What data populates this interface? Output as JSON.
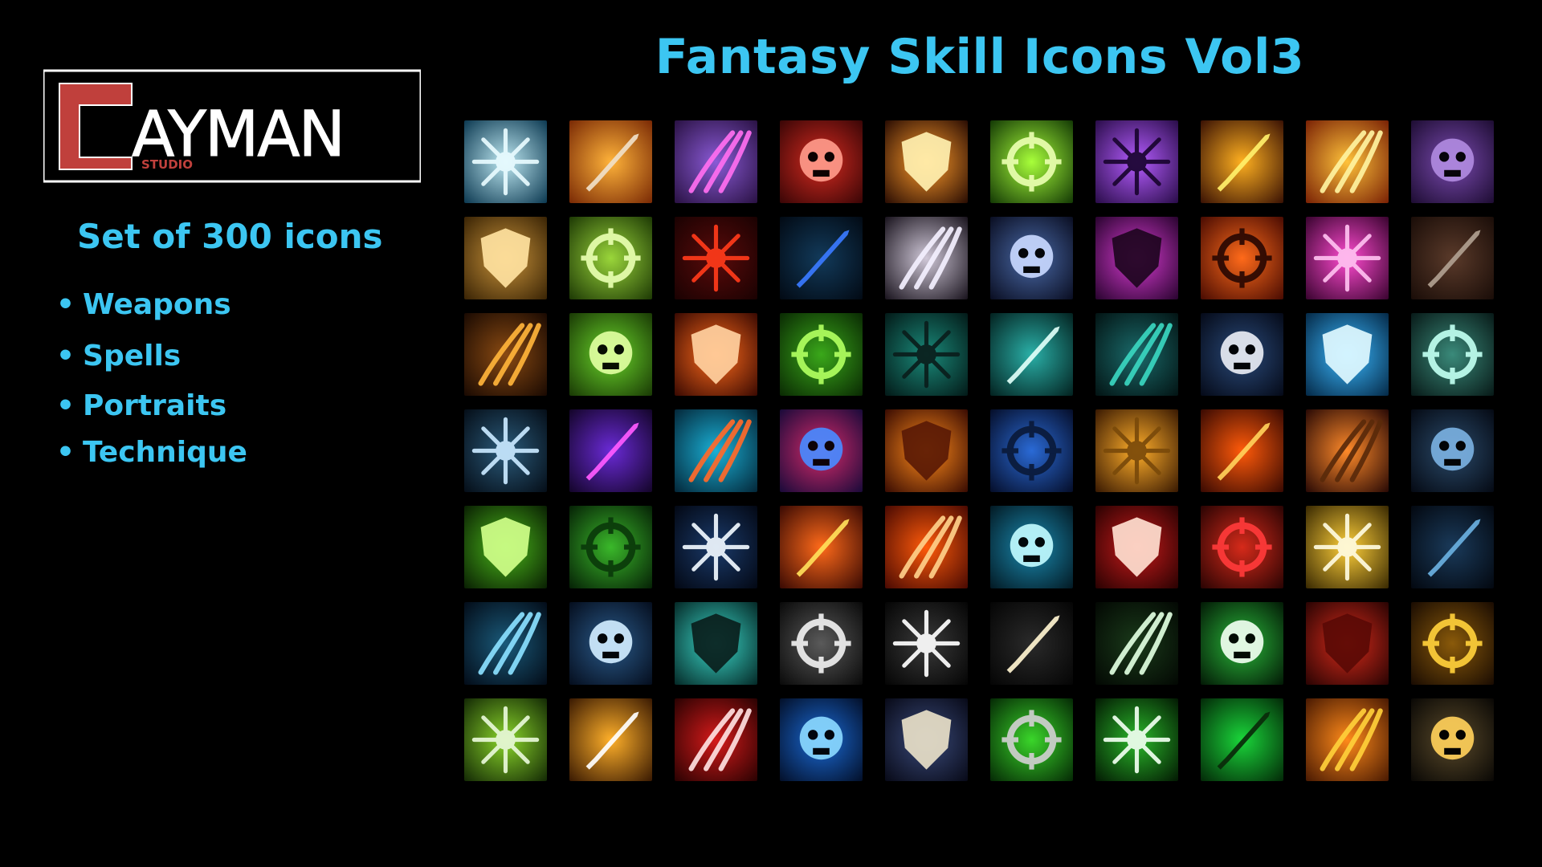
{
  "header": {
    "title": "Fantasy Skill Icons Vol3"
  },
  "logo": {
    "name": "AYMAN",
    "studio_label": "STUDIO"
  },
  "sidebar": {
    "subtitle": "Set of 300 icons",
    "bullet_char": "•",
    "features": [
      "Weapons",
      "Spells",
      "Portraits",
      "Technique"
    ]
  },
  "colors": {
    "accent": "#3cc6f2",
    "background": "#000000",
    "logo_red": "#c0403c"
  },
  "icons": [
    [
      {
        "name": "frost-burst-icon",
        "bg1": "#bde8f2",
        "bg2": "#0d3a52",
        "fg": "#e8fbff"
      },
      {
        "name": "skull-icon",
        "bg1": "#ffb33a",
        "bg2": "#7a2a05",
        "fg": "#f0e0c8"
      },
      {
        "name": "demon-face-icon",
        "bg1": "#8a5ad6",
        "bg2": "#2a1244",
        "fg": "#ff6ef0"
      },
      {
        "name": "claw-slash-icon",
        "bg1": "#d62a20",
        "bg2": "#3a0606",
        "fg": "#ff9a8a"
      },
      {
        "name": "sword-strike-icon",
        "bg1": "#ff9b2a",
        "bg2": "#2a0d03",
        "fg": "#fff0b0"
      },
      {
        "name": "green-blade-icon",
        "bg1": "#a8ff3a",
        "bg2": "#143a05",
        "fg": "#eaffb0"
      },
      {
        "name": "bat-swarm-icon",
        "bg1": "#b55cff",
        "bg2": "#2a0d4a",
        "fg": "#1a0530"
      },
      {
        "name": "comet-icon",
        "bg1": "#ffb020",
        "bg2": "#3a1204",
        "fg": "#fff06a"
      },
      {
        "name": "golden-wing-icon",
        "bg1": "#ffc23a",
        "bg2": "#7a2205",
        "fg": "#fff3a0"
      },
      {
        "name": "purple-claw-icon",
        "bg1": "#7a4ab0",
        "bg2": "#1e0d33",
        "fg": "#b08ae0"
      }
    ],
    [
      {
        "name": "shuriken-icon",
        "bg1": "#c9933a",
        "bg2": "#3a2405",
        "fg": "#ffe2a0"
      },
      {
        "name": "green-shuriken-icon",
        "bg1": "#9ad63a",
        "bg2": "#1e3a05",
        "fg": "#e8ffb0"
      },
      {
        "name": "blood-drops-icon",
        "bg1": "#5a0a0a",
        "bg2": "#1a0202",
        "fg": "#ff3a1a"
      },
      {
        "name": "sapphire-icon",
        "bg1": "#123a5a",
        "bg2": "#020a14",
        "fg": "#3a7aff"
      },
      {
        "name": "meteor-icon",
        "bg1": "#d0c8d8",
        "bg2": "#1a141e",
        "fg": "#f4f0ff"
      },
      {
        "name": "dark-helm-icon",
        "bg1": "#4a6aa8",
        "bg2": "#0a0e22",
        "fg": "#c8d8ff"
      },
      {
        "name": "cursed-sword-icon",
        "bg1": "#d63ad0",
        "bg2": "#2a0430",
        "fg": "#1e0520"
      },
      {
        "name": "fire-sword-icon",
        "bg1": "#ff6a1a",
        "bg2": "#4a0c02",
        "fg": "#2a0802"
      },
      {
        "name": "pink-axe-icon",
        "bg1": "#ff4ad0",
        "bg2": "#3a0430",
        "fg": "#ffc0f0"
      },
      {
        "name": "target-icon",
        "bg1": "#5a3a2a",
        "bg2": "#1a0d08",
        "fg": "#b0a090"
      }
    ],
    [
      {
        "name": "claw-grip-icon",
        "bg1": "#8a4a12",
        "bg2": "#1a0a02",
        "fg": "#ffb43a"
      },
      {
        "name": "green-slash-icon",
        "bg1": "#6ad62a",
        "bg2": "#1a3a05",
        "fg": "#e0ffa0"
      },
      {
        "name": "flaming-skull-icon",
        "bg1": "#ff6a1a",
        "bg2": "#3a0a02",
        "fg": "#ffd0a0"
      },
      {
        "name": "green-arrows-icon",
        "bg1": "#3aa81a",
        "bg2": "#0a2a03",
        "fg": "#b0ff60"
      },
      {
        "name": "paw-print-icon",
        "bg1": "#1a8a7a",
        "bg2": "#031a18",
        "fg": "#0a1e1c"
      },
      {
        "name": "sleep-scythe-icon",
        "bg1": "#2ab0a8",
        "bg2": "#032220",
        "fg": "#e0fff8"
      },
      {
        "name": "zombie-hand-icon",
        "bg1": "#1a6a6a",
        "bg2": "#031414",
        "fg": "#3ad6c0"
      },
      {
        "name": "grinning-skull-icon",
        "bg1": "#2a4a7a",
        "bg2": "#050a18",
        "fg": "#e8ecf4"
      },
      {
        "name": "ice-wing-icon",
        "bg1": "#3ab8ff",
        "bg2": "#052a48",
        "fg": "#e0f8ff"
      },
      {
        "name": "moon-strike-icon",
        "bg1": "#3a8a7a",
        "bg2": "#081a18",
        "fg": "#c0fff0"
      }
    ],
    [
      {
        "name": "wave-icon",
        "bg1": "#2a5a7a",
        "bg2": "#050e18",
        "fg": "#c8e8ff"
      },
      {
        "name": "swift-boot-icon",
        "bg1": "#6a2ad6",
        "bg2": "#14052a",
        "fg": "#ff5aff"
      },
      {
        "name": "dragon-claw-icon",
        "bg1": "#1ab0d6",
        "bg2": "#04283a",
        "fg": "#ff6a2a"
      },
      {
        "name": "goblin-portrait-icon",
        "bg1": "#d62a6a",
        "bg2": "#1a0a3a",
        "fg": "#4a8aff"
      },
      {
        "name": "fox-mask-icon",
        "bg1": "#ff8a1a",
        "bg2": "#3a0c02",
        "fg": "#5a1a05"
      },
      {
        "name": "wolf-mask-icon",
        "bg1": "#2a6ad6",
        "bg2": "#050e2a",
        "fg": "#0a1a3a"
      },
      {
        "name": "golden-shield-icon",
        "bg1": "#ffae2a",
        "bg2": "#3a1a02",
        "fg": "#7a4a0a"
      },
      {
        "name": "fire-pillar-icon",
        "bg1": "#ff5a0a",
        "bg2": "#3a0a02",
        "fg": "#ffd05a"
      },
      {
        "name": "knight-helm-icon",
        "bg1": "#ff8a2a",
        "bg2": "#2a0a05",
        "fg": "#5a2a0a"
      },
      {
        "name": "storm-star-icon",
        "bg1": "#2a4a6a",
        "bg2": "#050a14",
        "fg": "#7ab0e0"
      }
    ],
    [
      {
        "name": "green-explosion-icon",
        "bg1": "#4ab81a",
        "bg2": "#0a2003",
        "fg": "#d0ff8a"
      },
      {
        "name": "vortex-icon",
        "bg1": "#3ab82a",
        "bg2": "#062206",
        "fg": "#0a3a0a"
      },
      {
        "name": "shooting-stars-icon",
        "bg1": "#1a3a6a",
        "bg2": "#030814",
        "fg": "#f0f8ff"
      },
      {
        "name": "flame-maw-icon",
        "bg1": "#ff6a1a",
        "bg2": "#3a0a03",
        "fg": "#ffe05a"
      },
      {
        "name": "fire-whirl-icon",
        "bg1": "#ff5a0a",
        "bg2": "#4a0a02",
        "fg": "#ffd08a"
      },
      {
        "name": "lightning-lance-icon",
        "bg1": "#1a8ab0",
        "bg2": "#031a24",
        "fg": "#c0faff"
      },
      {
        "name": "blood-fangs-icon",
        "bg1": "#c81a1a",
        "bg2": "#2a0202",
        "fg": "#ffe0d0"
      },
      {
        "name": "blood-potion-icon",
        "bg1": "#d62a1a",
        "bg2": "#2a0403",
        "fg": "#ff3a3a"
      },
      {
        "name": "sun-target-icon",
        "bg1": "#ffd03a",
        "bg2": "#3a2a02",
        "fg": "#fffbe0"
      },
      {
        "name": "ice-crack-icon",
        "bg1": "#1a3a5a",
        "bg2": "#030810",
        "fg": "#6ab0e0"
      }
    ],
    [
      {
        "name": "tidal-wave-icon",
        "bg1": "#1a5a7a",
        "bg2": "#030c18",
        "fg": "#8ae0ff"
      },
      {
        "name": "wind-slash-icon",
        "bg1": "#2a5a8a",
        "bg2": "#050e1e",
        "fg": "#d0ecff"
      },
      {
        "name": "ghost-bats-icon",
        "bg1": "#3ad6c8",
        "bg2": "#052a28",
        "fg": "#0a1e1c"
      },
      {
        "name": "silver-spear-icon",
        "bg1": "#5a5a5a",
        "bg2": "#0a0a0a",
        "fg": "#f0f0f0"
      },
      {
        "name": "triple-swords-icon",
        "bg1": "#3a3a3a",
        "bg2": "#050505",
        "fg": "#ffffff"
      },
      {
        "name": "triple-arrow-bow-icon",
        "bg1": "#2a2a2a",
        "bg2": "#050505",
        "fg": "#fff4d0"
      },
      {
        "name": "bow-icon",
        "bg1": "#1a3a1a",
        "bg2": "#030803",
        "fg": "#e0ffe0"
      },
      {
        "name": "haunted-tree-icon",
        "bg1": "#2ab83a",
        "bg2": "#031a06",
        "fg": "#f0fff0"
      },
      {
        "name": "red-shield-icon",
        "bg1": "#d62a1a",
        "bg2": "#2a0403",
        "fg": "#5a0a05"
      },
      {
        "name": "golden-comet-icon",
        "bg1": "#8a5a0a",
        "bg2": "#1a0c02",
        "fg": "#ffd03a"
      }
    ],
    [
      {
        "name": "poison-sword-icon",
        "bg1": "#8ad62a",
        "bg2": "#142a05",
        "fg": "#e8f8d8"
      },
      {
        "name": "flame-sword-icon",
        "bg1": "#ffb02a",
        "bg2": "#3a1a02",
        "fg": "#ffffff"
      },
      {
        "name": "crimson-sword-icon",
        "bg1": "#d61a1a",
        "bg2": "#2a0202",
        "fg": "#ffe0e0"
      },
      {
        "name": "frost-claw-icon",
        "bg1": "#1a6ad6",
        "bg2": "#03102a",
        "fg": "#8ad8ff"
      },
      {
        "name": "screaming-skull-icon",
        "bg1": "#3a4a7a",
        "bg2": "#080a18",
        "fg": "#e8e0c8"
      },
      {
        "name": "green-eyed-skull-icon",
        "bg1": "#3ad62a",
        "bg2": "#052a05",
        "fg": "#d0d0d0"
      },
      {
        "name": "green-scythe-icon",
        "bg1": "#2ab82a",
        "bg2": "#031a03",
        "fg": "#f0fff0"
      },
      {
        "name": "green-arrow-burst-icon",
        "bg1": "#1ad63a",
        "bg2": "#032a08",
        "fg": "#0a2a0a"
      },
      {
        "name": "golden-cross-icon",
        "bg1": "#ff8a1a",
        "bg2": "#4a1a02",
        "fg": "#ffd03a"
      },
      {
        "name": "horned-helm-icon",
        "bg1": "#5a4a2a",
        "bg2": "#0a0805",
        "fg": "#ffd05a"
      }
    ]
  ]
}
